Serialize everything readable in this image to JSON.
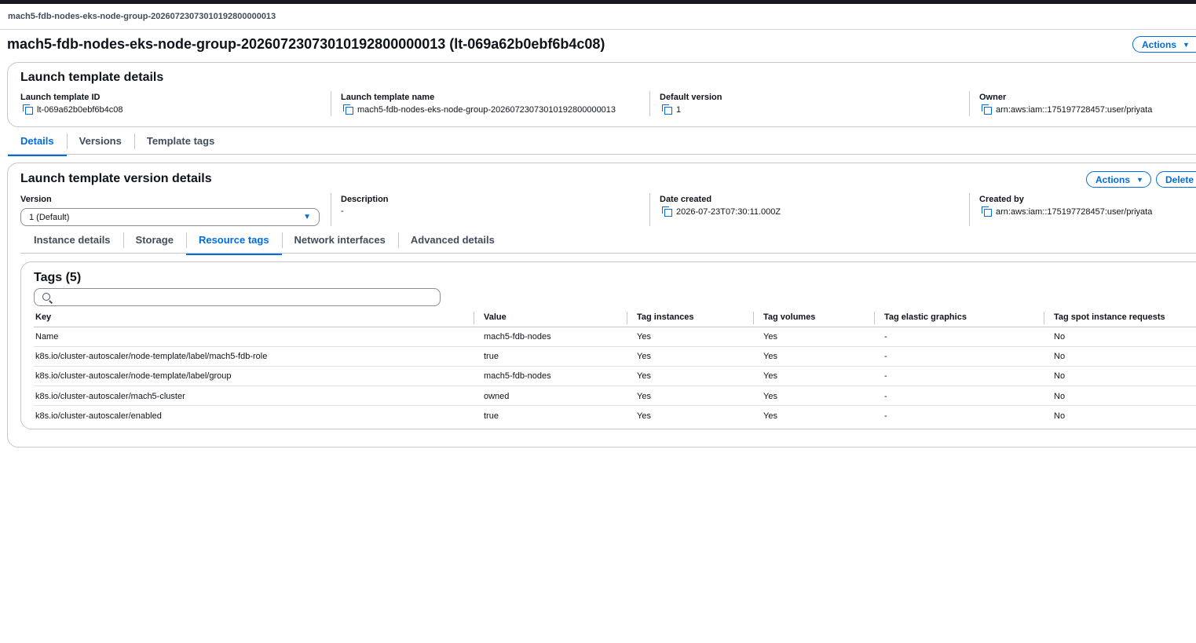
{
  "breadcrumb": "mach5-fdb-nodes-eks-node-group-20260723073010192800000013",
  "page_title": "mach5-fdb-nodes-eks-node-group-20260723073010192800000013 (lt-069a62b0ebf6b4c08)",
  "actions_label": "Actions",
  "delete_label": "Delete",
  "template_details": {
    "title": "Launch template details",
    "fields": [
      {
        "label": "Launch template ID",
        "value": "lt-069a62b0ebf6b4c08"
      },
      {
        "label": "Launch template name",
        "value": "mach5-fdb-nodes-eks-node-group-20260723073010192800000013"
      },
      {
        "label": "Default version",
        "value": "1"
      },
      {
        "label": "Owner",
        "value": "arn:aws:iam::175197728457:user/priyata"
      }
    ]
  },
  "top_tabs": [
    "Details",
    "Versions",
    "Template tags"
  ],
  "version_details": {
    "title": "Launch template version details",
    "version_label": "Version",
    "version_value": "1 (Default)",
    "description_label": "Description",
    "description_value": "-",
    "date_created_label": "Date created",
    "date_created_value": "2026-07-23T07:30:11.000Z",
    "created_by_label": "Created by",
    "created_by_value": "arn:aws:iam::175197728457:user/priyata"
  },
  "sub_tabs": [
    "Instance details",
    "Storage",
    "Resource tags",
    "Network interfaces",
    "Advanced details"
  ],
  "tags": {
    "title": "Tags (5)",
    "columns": [
      "Key",
      "Value",
      "Tag instances",
      "Tag volumes",
      "Tag elastic graphics",
      "Tag spot instance requests"
    ],
    "rows": [
      [
        "Name",
        "mach5-fdb-nodes",
        "Yes",
        "Yes",
        "-",
        "No"
      ],
      [
        "k8s.io/cluster-autoscaler/node-template/label/mach5-fdb-role",
        "true",
        "Yes",
        "Yes",
        "-",
        "No"
      ],
      [
        "k8s.io/cluster-autoscaler/node-template/label/group",
        "mach5-fdb-nodes",
        "Yes",
        "Yes",
        "-",
        "No"
      ],
      [
        "k8s.io/cluster-autoscaler/mach5-cluster",
        "owned",
        "Yes",
        "Yes",
        "-",
        "No"
      ],
      [
        "k8s.io/cluster-autoscaler/enabled",
        "true",
        "Yes",
        "Yes",
        "-",
        "No"
      ]
    ]
  },
  "colors": {
    "accent": "#006ce0",
    "text": "#0f141a",
    "border": "#c6c6cd",
    "topbar": "#16191f"
  }
}
